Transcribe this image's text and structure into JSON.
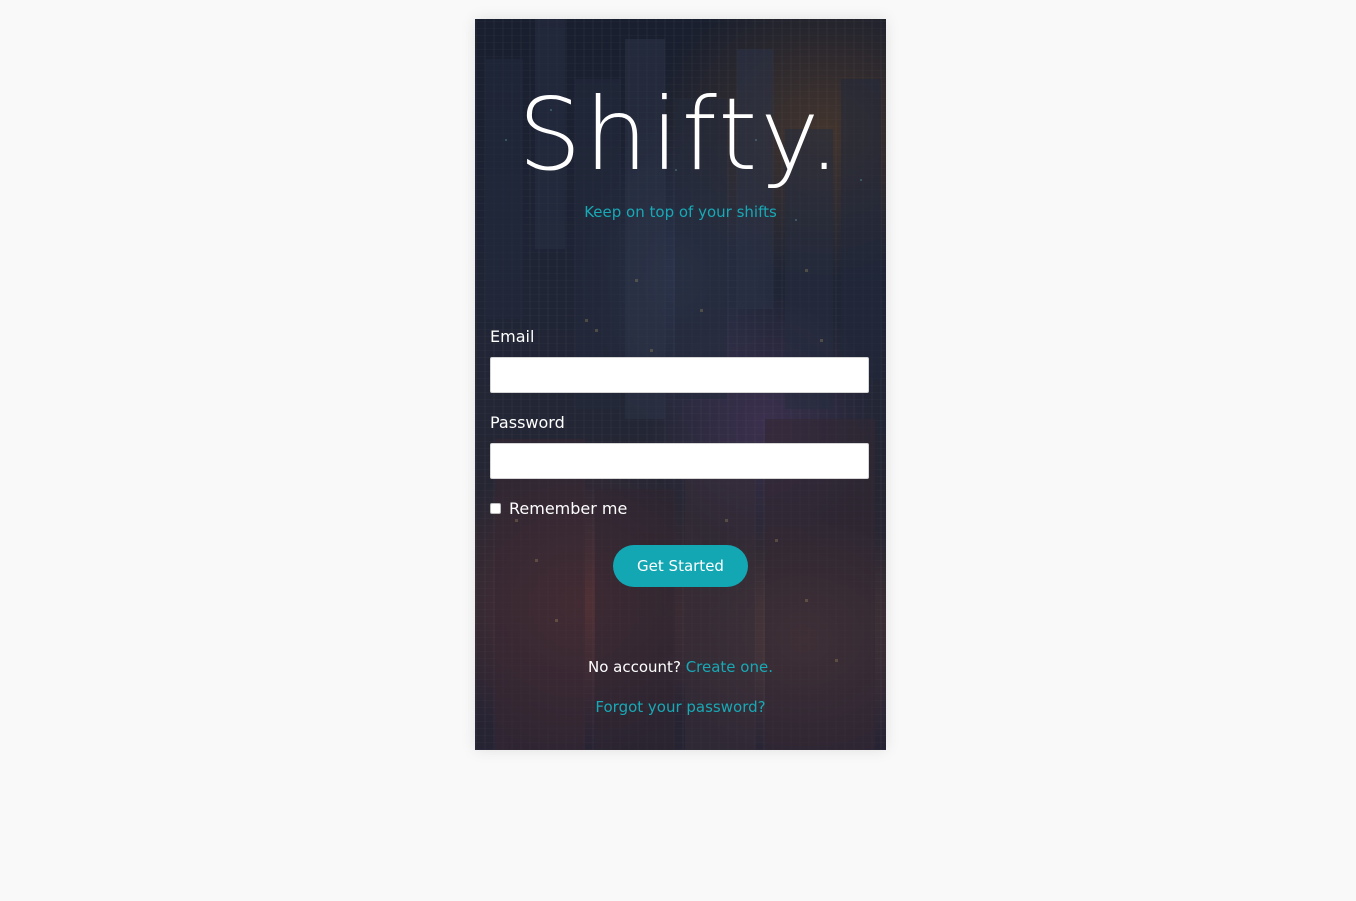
{
  "brand": {
    "logo": "Shifty.",
    "tagline": "Keep on top of your shifts"
  },
  "form": {
    "email_label": "Email",
    "email_value": "",
    "password_label": "Password",
    "password_value": "",
    "remember_label": "Remember me",
    "remember_checked": false,
    "submit_label": "Get Started"
  },
  "footer": {
    "no_account_text": "No account?",
    "create_link": "Create one.",
    "forgot_link": "Forgot your password?"
  },
  "colors": {
    "accent": "#12a7b3",
    "page_background": "#f9f9f9"
  }
}
